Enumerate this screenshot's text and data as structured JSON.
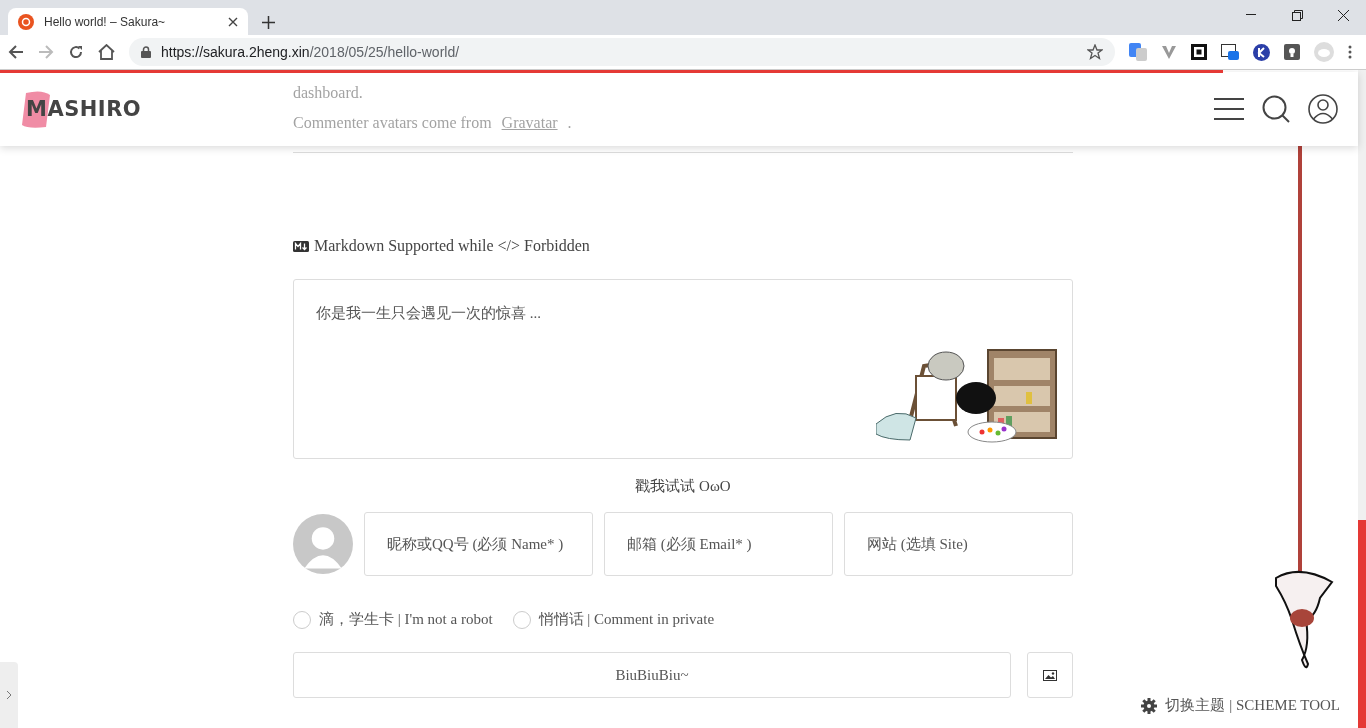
{
  "browser": {
    "tab_title": "Hello world! – Sakura~",
    "url_host": "https://sakura.2heng.xin",
    "url_path": "/2018/05/25/hello-world/"
  },
  "reading_progress": {
    "level": 0.895
  },
  "header": {
    "logo": "MASHIRO"
  },
  "article_tail": {
    "line_1": "dashboard.",
    "line_2_before": "Commenter avatars come from",
    "line_2_link": "Gravatar",
    "line_2_after": "."
  },
  "comment_form": {
    "heading_before": "Markdown Supported while",
    "heading_code": "</>",
    "heading_after": "Forbidden",
    "textarea_placeholder": "你是我一生只会遇见一次的惊喜 ...",
    "emoji_toggle": "戳我试试 OωO",
    "fields": [
      {
        "placeholder": "昵称或QQ号 (必须 Name* )"
      },
      {
        "placeholder": "邮箱 (必须 Email* )"
      },
      {
        "placeholder": "网站 (选填 Site)"
      }
    ],
    "checkboxes": [
      {
        "label": "滴，学生卡 | I'm not a robot",
        "checked": false
      },
      {
        "label": "悄悄话 | Comment in private",
        "checked": false
      }
    ],
    "submit": "BiuBiuBiu~"
  },
  "scheme_tool": "切换主题 | SCHEME TOOL"
}
